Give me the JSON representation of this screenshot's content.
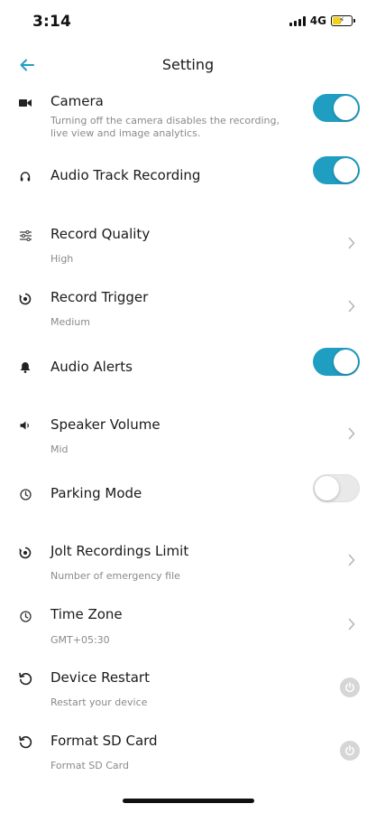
{
  "status_bar": {
    "time": "3:14",
    "network": "4G",
    "battery_color": "#f2d21a"
  },
  "header": {
    "back_icon": "arrow-left-icon",
    "title": "Setting"
  },
  "colors": {
    "accent": "#1f9ec2",
    "toggle_off": "#e9e9ea",
    "subtitle": "#8a8a8a"
  },
  "settings": {
    "camera": {
      "icon": "video-camera-icon",
      "title": "Camera",
      "subtitle_line1": "Turning off the camera disables the recording,",
      "subtitle_line2": "live view and image analytics.",
      "enabled": true
    },
    "audio_track": {
      "icon": "headphones-icon",
      "title": "Audio Track Recording",
      "enabled": true
    },
    "record_quality": {
      "icon": "sliders-icon",
      "title": "Record Quality",
      "value": "High"
    },
    "record_trigger": {
      "icon": "trigger-icon",
      "title": "Record Trigger",
      "value": "Medium"
    },
    "audio_alerts": {
      "icon": "bell-icon",
      "title": "Audio Alerts",
      "enabled": true
    },
    "speaker_volume": {
      "icon": "speaker-icon",
      "title": "Speaker Volume",
      "value": "Mid"
    },
    "parking_mode": {
      "icon": "clock-icon",
      "title": "Parking Mode",
      "enabled": false
    },
    "jolt_limit": {
      "icon": "trigger-icon",
      "title": "Jolt Recordings Limit",
      "value": "Number of emergency file"
    },
    "time_zone": {
      "icon": "clock-icon",
      "title": "Time Zone",
      "value": "GMT+05:30"
    },
    "device_restart": {
      "icon": "restart-icon",
      "title": "Device Restart",
      "subtitle": "Restart your device",
      "action_icon": "power-icon"
    },
    "format_sd": {
      "icon": "restart-icon",
      "title": "Format SD Card",
      "subtitle": "Format SD Card",
      "action_icon": "power-icon"
    }
  }
}
